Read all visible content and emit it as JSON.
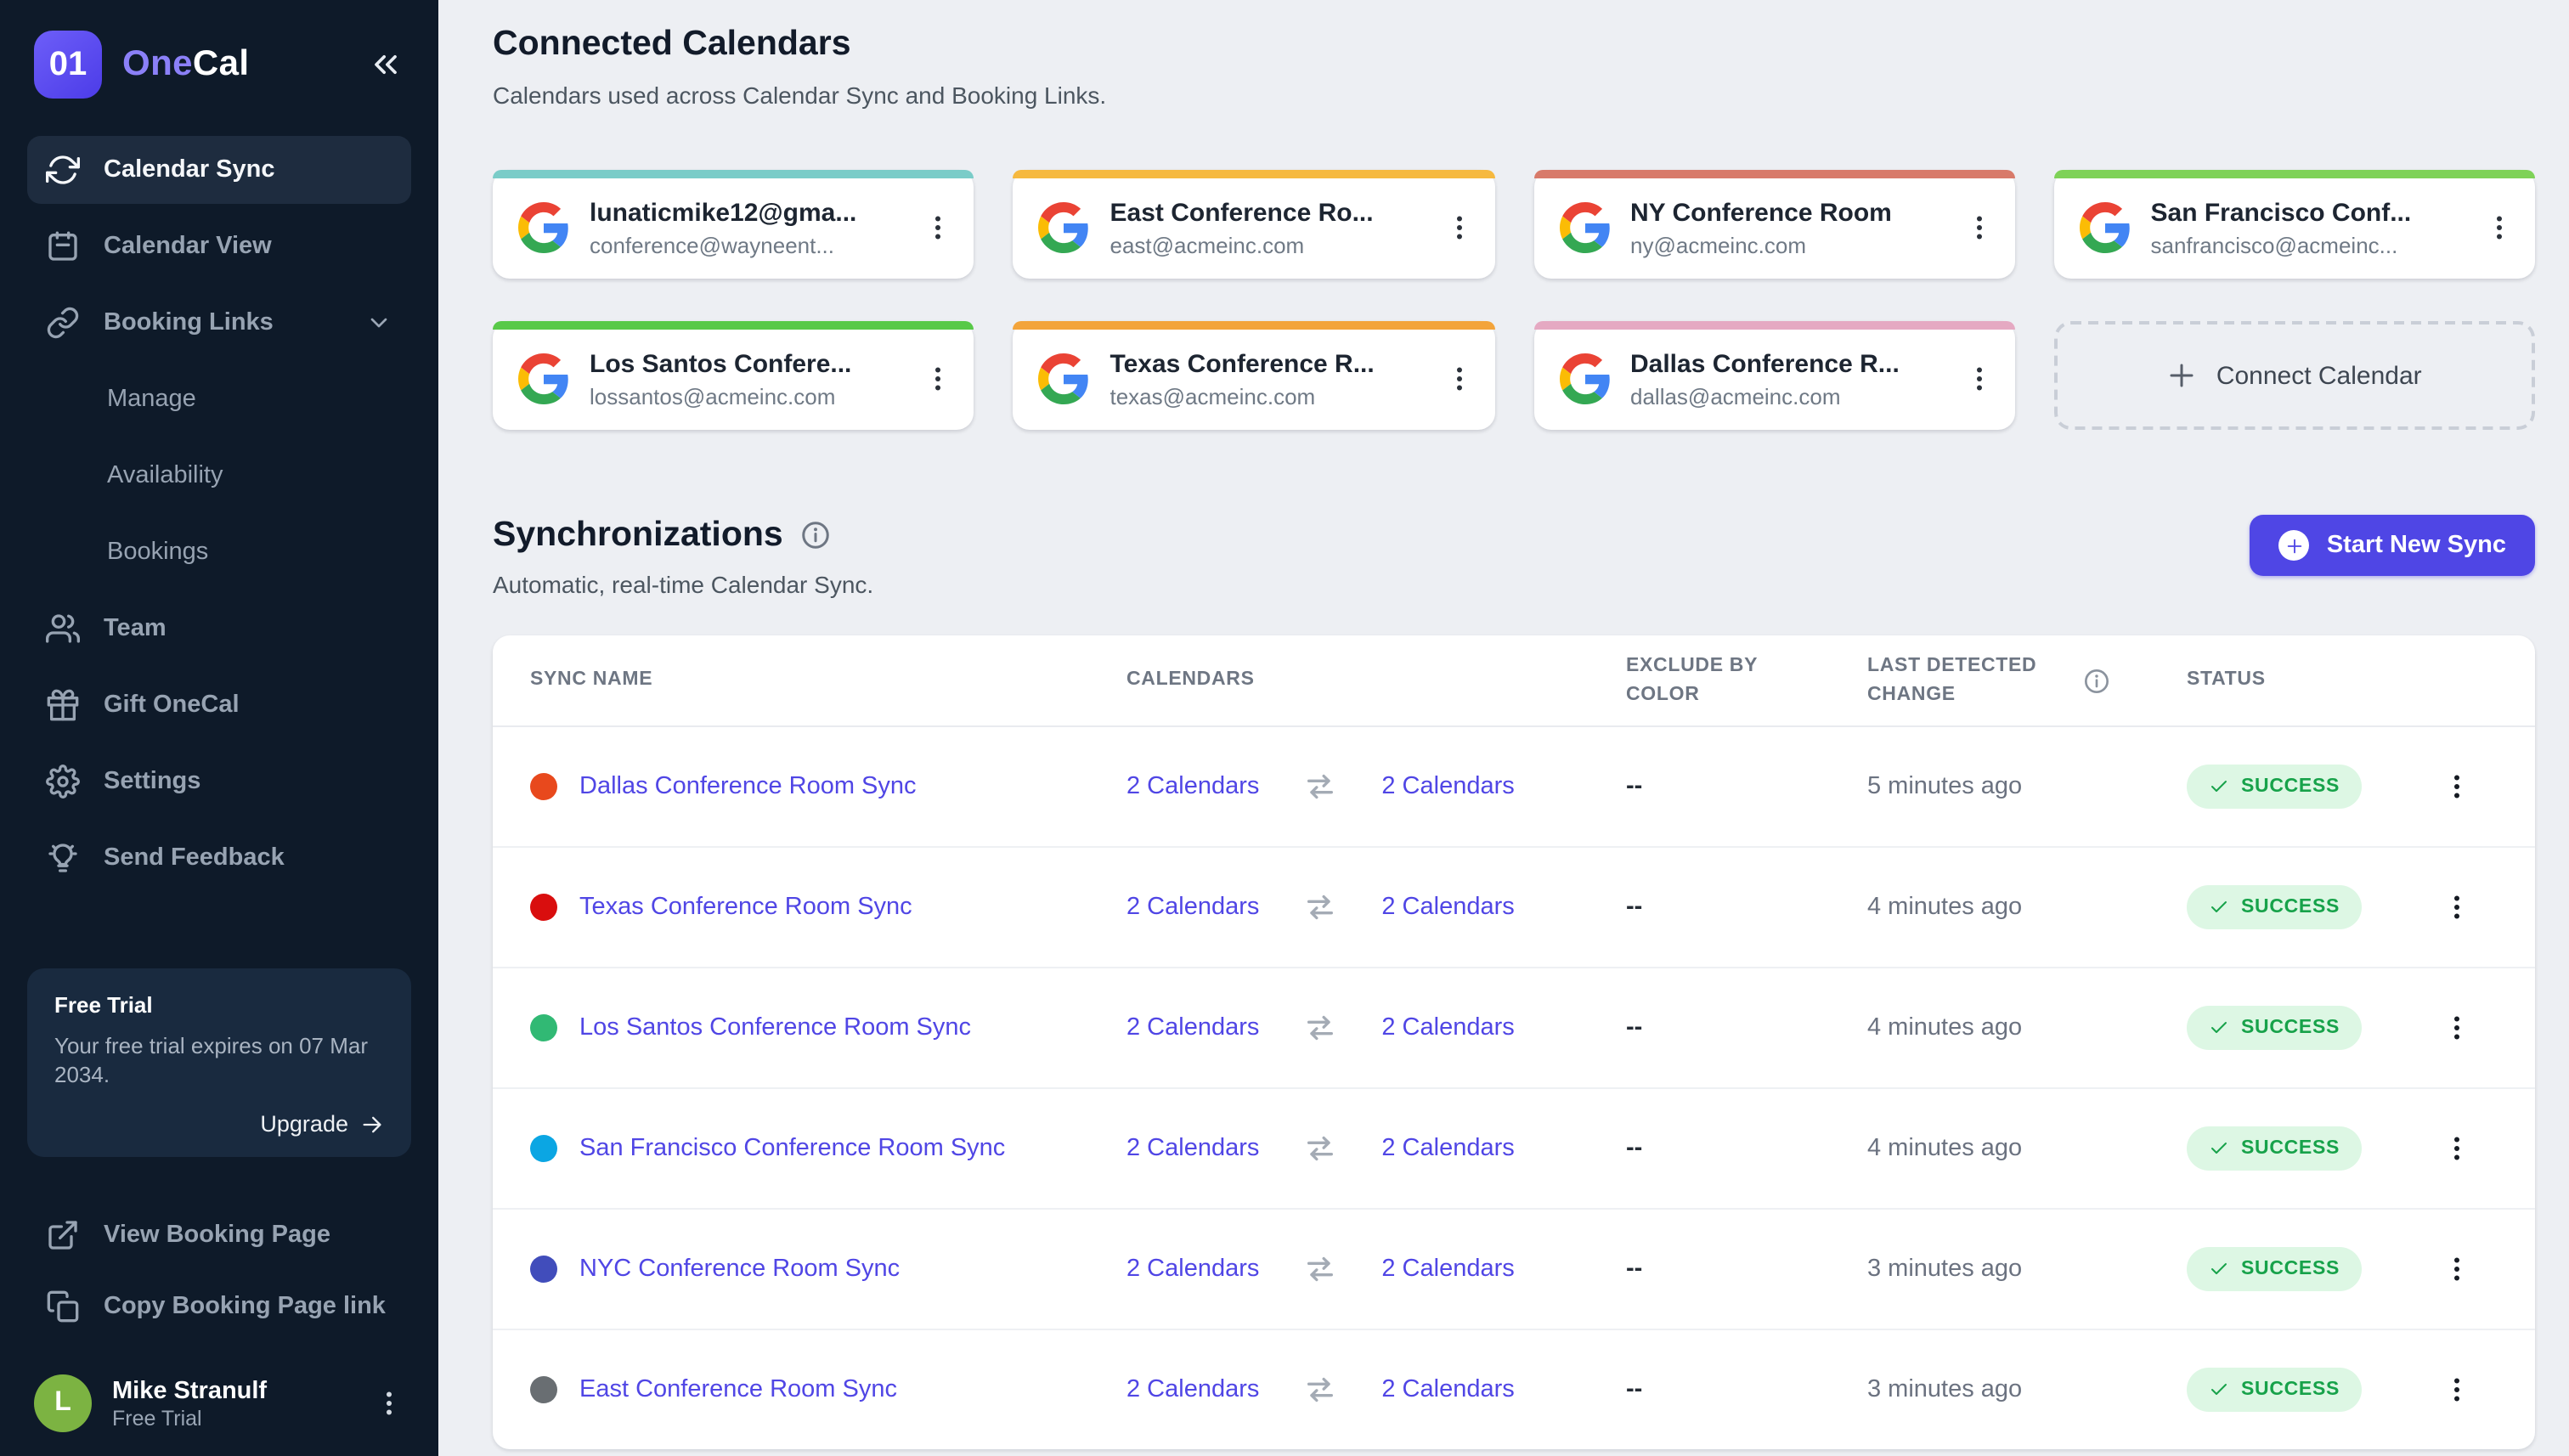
{
  "app": {
    "logo_text": "01",
    "name_primary": "One",
    "name_secondary": "Cal"
  },
  "colors": {
    "accent": "#4f46e5",
    "sidebar_bg": "#0e1a29",
    "badge_bg": "#ddf7e4",
    "badge_text": "#17a24a"
  },
  "sidebar": {
    "items": [
      {
        "label": "Calendar Sync",
        "icon": "sync-icon",
        "active": true
      },
      {
        "label": "Calendar View",
        "icon": "calendar-icon"
      },
      {
        "label": "Booking Links",
        "icon": "link-icon",
        "chevron": true
      },
      {
        "label": "Manage",
        "sub": true
      },
      {
        "label": "Availability",
        "sub": true
      },
      {
        "label": "Bookings",
        "sub": true
      },
      {
        "label": "Team",
        "icon": "team-icon"
      },
      {
        "label": "Gift OneCal",
        "icon": "gift-icon"
      },
      {
        "label": "Settings",
        "icon": "settings-icon"
      },
      {
        "label": "Send Feedback",
        "icon": "feedback-icon"
      }
    ],
    "free_trial": {
      "title": "Free Trial",
      "body": "Your free trial expires on 07 Mar 2034.",
      "cta": "Upgrade"
    },
    "footer_links": [
      {
        "label": "View Booking Page",
        "icon": "external-link-icon"
      },
      {
        "label": "Copy Booking Page link",
        "icon": "copy-icon"
      }
    ],
    "user": {
      "name": "Mike Stranulf",
      "plan": "Free Trial",
      "avatar_initial": "L",
      "avatar_color": "#7cb342"
    }
  },
  "connected": {
    "title": "Connected Calendars",
    "subtitle": "Calendars used across Calendar Sync and Booking Links.",
    "cards": [
      {
        "title": "lunaticmike12@gma...",
        "email": "conference@wayneent...",
        "bar_color": "#7accc8"
      },
      {
        "title": "East Conference Ro...",
        "email": "east@acmeinc.com",
        "bar_color": "#f6b93f"
      },
      {
        "title": "NY Conference Room",
        "email": "ny@acmeinc.com",
        "bar_color": "#d87a6a"
      },
      {
        "title": "San Francisco Conf...",
        "email": "sanfrancisco@acmeinc...",
        "bar_color": "#7ed257"
      },
      {
        "title": "Los Santos Confere...",
        "email": "lossantos@acmeinc.com",
        "bar_color": "#58c948"
      },
      {
        "title": "Texas Conference R...",
        "email": "texas@acmeinc.com",
        "bar_color": "#f3a43b"
      },
      {
        "title": "Dallas Conference R...",
        "email": "dallas@acmeinc.com",
        "bar_color": "#e5a9c2"
      }
    ],
    "connect_button": {
      "label": "Connect Calendar"
    }
  },
  "sync": {
    "title": "Synchronizations",
    "subtitle": "Automatic, real-time Calendar Sync.",
    "button_label": "Start New Sync",
    "table": {
      "headers": [
        {
          "label": "SYNC NAME"
        },
        {
          "label": "CALENDARS"
        },
        {
          "label": "EXCLUDE BY COLOR",
          "wrap": 92
        },
        {
          "label": "LAST DETECTED CHANGE",
          "wrap": 118,
          "icon": "info-icon"
        },
        {
          "label": "STATUS"
        }
      ],
      "rows": [
        {
          "name": "Dallas Conference Room Sync",
          "dot_color": "#e8491d",
          "cal_left": "2 Calendars",
          "cal_right": "2 Calendars",
          "exclude": "--",
          "last_change": "5 minutes ago",
          "status": "SUCCESS"
        },
        {
          "name": "Texas Conference Room Sync",
          "dot_color": "#d90e0e",
          "cal_left": "2 Calendars",
          "cal_right": "2 Calendars",
          "exclude": "--",
          "last_change": "4 minutes ago",
          "status": "SUCCESS"
        },
        {
          "name": "Los Santos Conference Room Sync",
          "dot_color": "#31b974",
          "cal_left": "2 Calendars",
          "cal_right": "2 Calendars",
          "exclude": "--",
          "last_change": "4 minutes ago",
          "status": "SUCCESS"
        },
        {
          "name": "San Francisco Conference Room Sync",
          "dot_color": "#0ba6e3",
          "cal_left": "2 Calendars",
          "cal_right": "2 Calendars",
          "exclude": "--",
          "last_change": "4 minutes ago",
          "status": "SUCCESS"
        },
        {
          "name": "NYC Conference Room Sync",
          "dot_color": "#414dbb",
          "cal_left": "2 Calendars",
          "cal_right": "2 Calendars",
          "exclude": "--",
          "last_change": "3 minutes ago",
          "status": "SUCCESS"
        },
        {
          "name": "East Conference Room Sync",
          "dot_color": "#696e72",
          "cal_left": "2 Calendars",
          "cal_right": "2 Calendars",
          "exclude": "--",
          "last_change": "3 minutes ago",
          "status": "SUCCESS"
        }
      ]
    }
  }
}
